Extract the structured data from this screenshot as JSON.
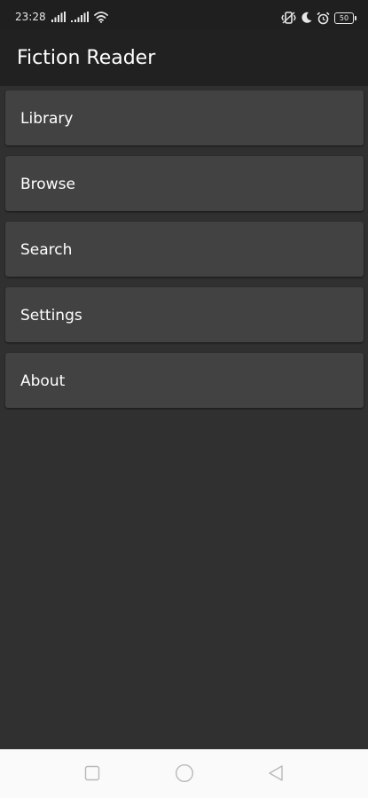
{
  "status_bar": {
    "time": "23:28",
    "battery_level": "50",
    "left_icons": [
      "signal-icon",
      "signal-icon",
      "wifi-icon"
    ],
    "right_icons": [
      "vibrate-icon",
      "moon-icon",
      "alarm-icon",
      "battery-icon"
    ]
  },
  "app_bar": {
    "title": "Fiction Reader"
  },
  "menu": {
    "items": [
      {
        "label": "Library"
      },
      {
        "label": "Browse"
      },
      {
        "label": "Search"
      },
      {
        "label": "Settings"
      },
      {
        "label": "About"
      }
    ]
  },
  "nav_bar": {
    "buttons": [
      "recents-icon",
      "home-icon",
      "back-icon"
    ]
  },
  "colors": {
    "background": "#303030",
    "app_bar": "#212121",
    "menu_item": "#424242",
    "text": "#ffffff",
    "nav_bar": "#fafafa"
  }
}
